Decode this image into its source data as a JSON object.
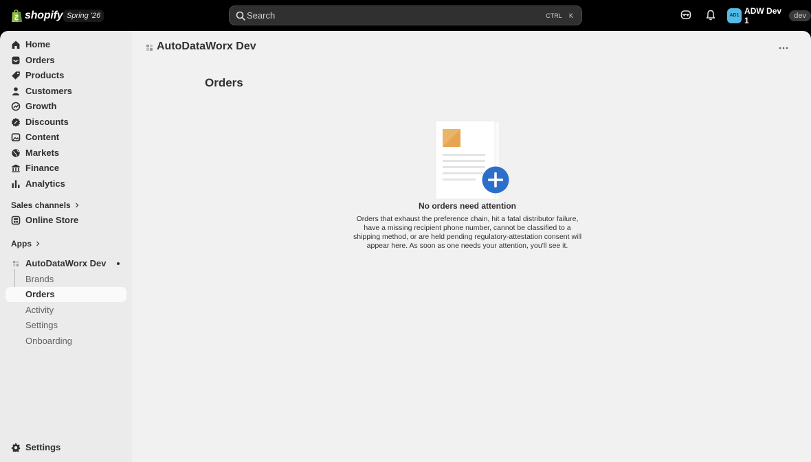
{
  "topbar": {
    "brand": "shopify",
    "edition": "Spring '26",
    "search_placeholder": "Search",
    "search_shortcut_1": "CTRL",
    "search_shortcut_2": "K",
    "account_initials": "AD1",
    "account_name": "ADW Dev 1",
    "account_badge": "dev",
    "avatar_color": "#53bbe6"
  },
  "sidebar": {
    "items": [
      {
        "label": "Home",
        "icon": "home-icon"
      },
      {
        "label": "Orders",
        "icon": "inbox-icon"
      },
      {
        "label": "Products",
        "icon": "tag-icon"
      },
      {
        "label": "Customers",
        "icon": "person-icon"
      },
      {
        "label": "Growth",
        "icon": "growth-icon"
      },
      {
        "label": "Discounts",
        "icon": "discount-icon"
      },
      {
        "label": "Content",
        "icon": "content-icon"
      },
      {
        "label": "Markets",
        "icon": "globe-icon"
      },
      {
        "label": "Finance",
        "icon": "bank-icon"
      },
      {
        "label": "Analytics",
        "icon": "bar-chart-icon"
      }
    ],
    "sales_channels_label": "Sales channels",
    "online_store_label": "Online Store",
    "apps_label": "Apps",
    "app_name": "AutoDataWorx Dev",
    "app_subitems": [
      "Brands",
      "Orders",
      "Activity",
      "Settings",
      "Onboarding"
    ],
    "active_subitem": "Orders",
    "settings_label": "Settings"
  },
  "main": {
    "app_title": "AutoDataWorx Dev",
    "page_title": "Orders",
    "empty_heading": "No orders need attention",
    "empty_body": "Orders that exhaust the preference chain, hit a fatal distributor failure, have a missing recipient phone number, cannot be classified to a shipping method, or are held pending regulatory-attestation consent will appear here. As soon as one needs your attention, you'll see it."
  },
  "colors": {
    "topbar_bg": "#000000",
    "sidebar_bg": "#ebebeb",
    "main_bg": "#f1f1f1",
    "accent_blue": "#2c6ecb",
    "illustration_orange": "#e7a552"
  }
}
